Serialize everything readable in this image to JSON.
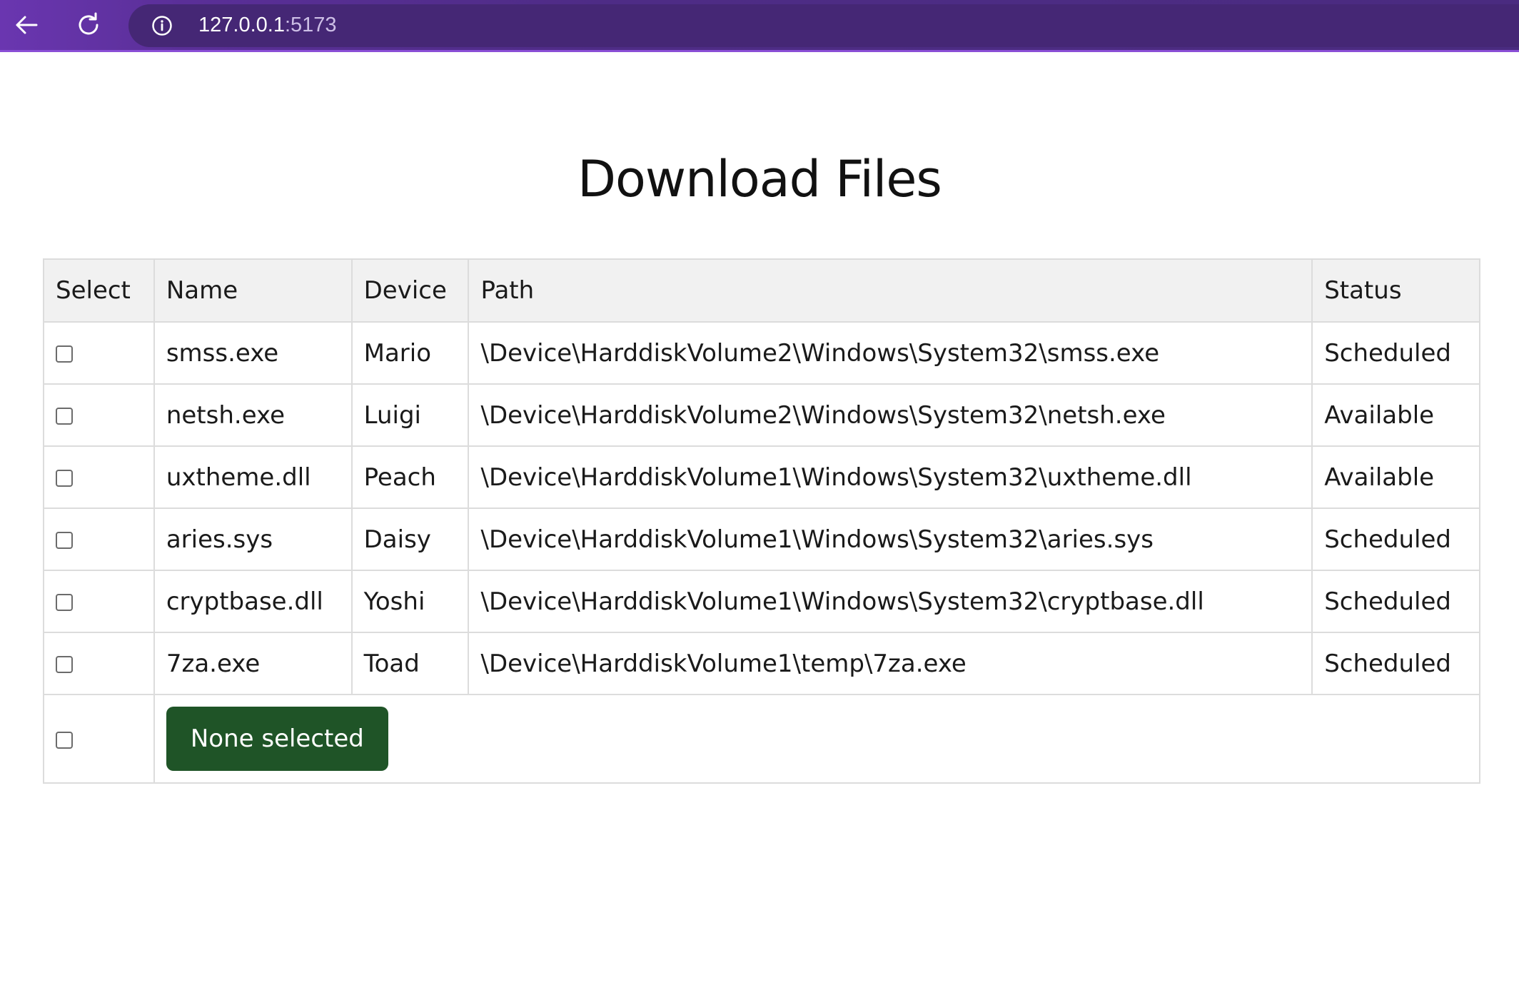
{
  "browser": {
    "url_host": "127.0.0.1",
    "url_port": ":5173"
  },
  "page": {
    "title": "Download Files"
  },
  "table": {
    "headers": [
      "Select",
      "Name",
      "Device",
      "Path",
      "Status"
    ],
    "rows": [
      {
        "name": "smss.exe",
        "device": "Mario",
        "path": "\\Device\\HarddiskVolume2\\Windows\\System32\\smss.exe",
        "status": "Scheduled"
      },
      {
        "name": "netsh.exe",
        "device": "Luigi",
        "path": "\\Device\\HarddiskVolume2\\Windows\\System32\\netsh.exe",
        "status": "Available"
      },
      {
        "name": "uxtheme.dll",
        "device": "Peach",
        "path": "\\Device\\HarddiskVolume1\\Windows\\System32\\uxtheme.dll",
        "status": "Available"
      },
      {
        "name": "aries.sys",
        "device": "Daisy",
        "path": "\\Device\\HarddiskVolume1\\Windows\\System32\\aries.sys",
        "status": "Scheduled"
      },
      {
        "name": "cryptbase.dll",
        "device": "Yoshi",
        "path": "\\Device\\HarddiskVolume1\\Windows\\System32\\cryptbase.dll",
        "status": "Scheduled"
      },
      {
        "name": "7za.exe",
        "device": "Toad",
        "path": "\\Device\\HarddiskVolume1\\temp\\7za.exe",
        "status": "Scheduled"
      }
    ],
    "footer_button_label": "None selected"
  },
  "colors": {
    "browser_bar": "#4e2c86",
    "header_bg": "#f1f1f1",
    "button_bg": "#1f5427",
    "border": "#dcdcdc"
  },
  "icons": [
    "back-arrow-icon",
    "reload-icon",
    "info-icon"
  ]
}
